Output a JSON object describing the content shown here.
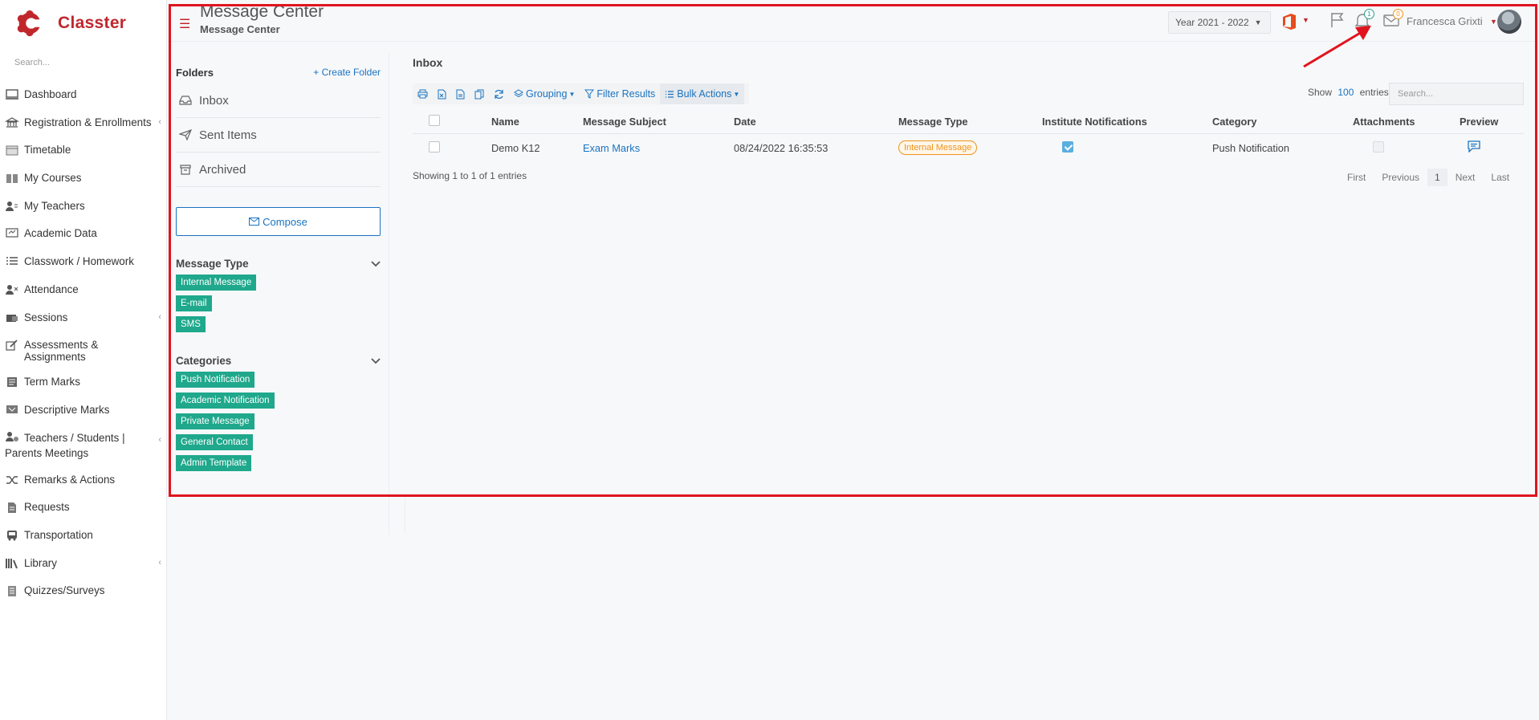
{
  "app": {
    "name": "Classter"
  },
  "sidebar": {
    "search_placeholder": "Search...",
    "items": [
      {
        "label": "Dashboard",
        "icon": "monitor-icon"
      },
      {
        "label": "Registration & Enrollments",
        "icon": "institution-icon",
        "has_caret": true
      },
      {
        "label": "Timetable",
        "icon": "calendar-icon"
      },
      {
        "label": "My Courses",
        "icon": "book-icon"
      },
      {
        "label": "My Teachers",
        "icon": "users-icon"
      },
      {
        "label": "Academic Data",
        "icon": "chalkboard-icon"
      },
      {
        "label": "Classwork / Homework",
        "icon": "list-icon"
      },
      {
        "label": "Attendance",
        "icon": "user-x-icon"
      },
      {
        "label": "Sessions",
        "icon": "projector-icon",
        "has_caret": true
      },
      {
        "label": "Assessments & Assignments",
        "icon": "edit-icon"
      },
      {
        "label": "Term Marks",
        "icon": "grades-icon"
      },
      {
        "label": "Descriptive Marks",
        "icon": "comment-icon"
      },
      {
        "label": "Teachers / Students |",
        "label2": "Parents Meetings",
        "icon": "meeting-icon",
        "has_caret": true
      },
      {
        "label": "Remarks & Actions",
        "icon": "random-icon"
      },
      {
        "label": "Requests",
        "icon": "file-icon"
      },
      {
        "label": "Transportation",
        "icon": "bus-icon"
      },
      {
        "label": "Library",
        "icon": "library-icon",
        "has_caret": true
      },
      {
        "label": "Quizzes/Surveys",
        "icon": "survey-icon"
      }
    ]
  },
  "header": {
    "title": "Message Center",
    "breadcrumb": "Message Center",
    "year": "Year 2021 - 2022",
    "notifications_count": "1",
    "messages_count": "0",
    "user_name": "Francesca Grixti"
  },
  "folders": {
    "heading": "Folders",
    "create_label": "Create Folder",
    "items": [
      {
        "label": "Inbox",
        "icon": "inbox-icon"
      },
      {
        "label": "Sent Items",
        "icon": "paper-plane-icon"
      },
      {
        "label": "Archived",
        "icon": "archive-icon"
      }
    ],
    "compose_label": "Compose"
  },
  "message_types": {
    "heading": "Message Type",
    "tags": [
      "Internal Message",
      "E-mail",
      "SMS"
    ]
  },
  "categories": {
    "heading": "Categories",
    "tags": [
      "Push Notification",
      "Academic Notification",
      "Private Message",
      "General Contact",
      "Admin Template"
    ]
  },
  "inbox": {
    "title": "Inbox",
    "toolbar": {
      "grouping": "Grouping",
      "filter": "Filter Results",
      "bulk": "Bulk Actions"
    },
    "show_label": "Show",
    "show_count": "100",
    "entries_label": "entries",
    "search_placeholder": "Search...",
    "columns": [
      "Name",
      "Message Subject",
      "Date",
      "Message Type",
      "Institute Notifications",
      "Category",
      "Attachments",
      "Preview"
    ],
    "rows": [
      {
        "name": "Demo K12",
        "subject": "Exam Marks",
        "date": "08/24/2022 16:35:53",
        "type": "Internal Message",
        "institute_notifications": true,
        "category": "Push Notification",
        "attachments": false
      }
    ],
    "showing": "Showing 1 to 1 of 1 entries",
    "pager": {
      "first": "First",
      "previous": "Previous",
      "page": "1",
      "next": "Next",
      "last": "Last"
    }
  },
  "colors": {
    "brand": "#c0272d",
    "tag": "#1fa88c",
    "link": "#1a73c0",
    "annotation": "#e0141e"
  }
}
